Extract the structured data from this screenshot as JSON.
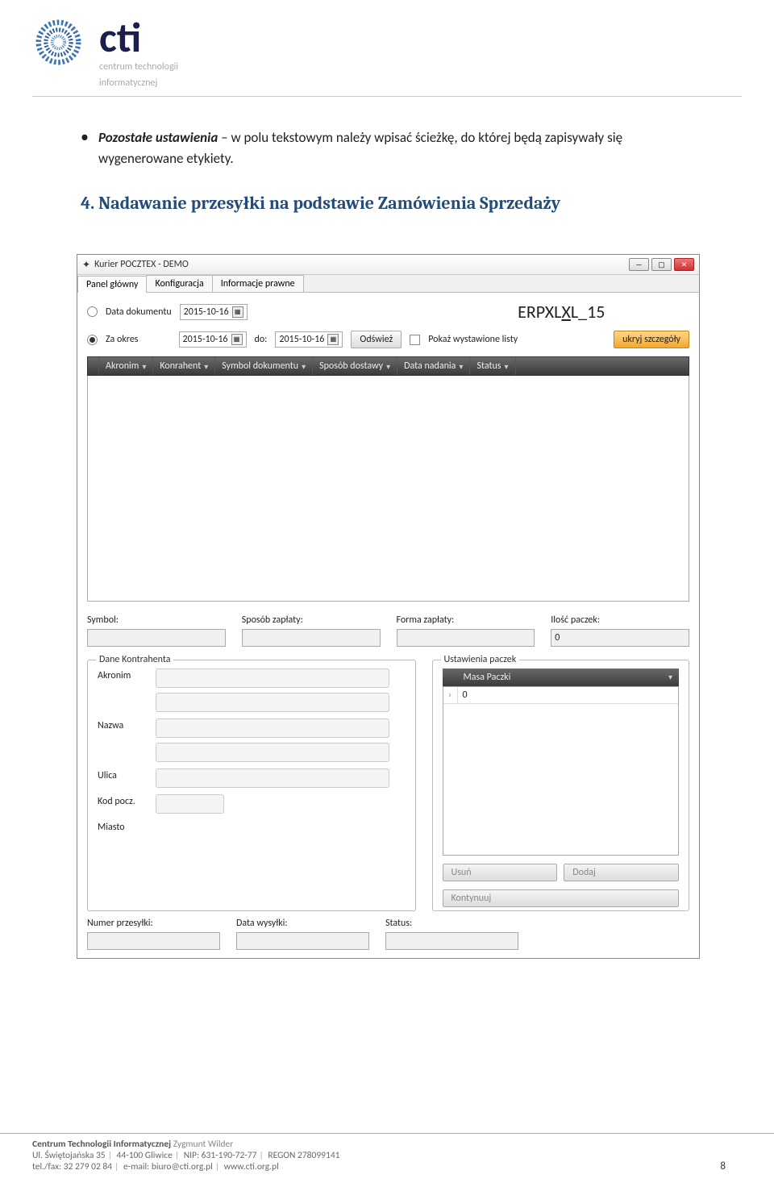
{
  "header": {
    "brand": "cti",
    "sub1": "centrum technologii",
    "sub2": "informatycznej"
  },
  "bullet": {
    "term": "Pozostałe ustawienia",
    "rest": " – w polu tekstowym należy wpisać ścieżkę, do której będą zapisywały się wygenerowane etykiety."
  },
  "heading": "4. Nadawanie przesyłki na podstawie Zamówienia Sprzedaży",
  "win": {
    "title": "Kurier POCZTEX - DEMO",
    "min": "—",
    "max": "▢",
    "close": "✕"
  },
  "tabs": [
    "Panel główny",
    "Konfiguracja",
    "Informacje prawne"
  ],
  "filters": {
    "docDateLbl": "Data dokumentu",
    "docDate": "2015-10-16",
    "periodLbl": "Za okres",
    "from": "2015-10-16",
    "doLbl": "do:",
    "to": "2015-10-16",
    "refresh": "Odśwież",
    "showLbl": "Pokaż wystawione listy",
    "hideBtn": "ukryj szczegóły",
    "erp": "ERPXLXL_15"
  },
  "gridCols": [
    "Akronim",
    "Konrahent",
    "Symbol dokumentu",
    "Sposób dostawy",
    "Data nadania",
    "Status"
  ],
  "form": {
    "symbolLbl": "Symbol:",
    "sposobLbl": "Sposób zapłaty:",
    "formaLbl": "Forma zapłaty:",
    "iloscLbl": "Ilość paczek:",
    "iloscVal": "0"
  },
  "kont": {
    "title": "Dane Kontrahenta",
    "akronim": "Akronim",
    "nazwa": "Nazwa",
    "ulica": "Ulica",
    "kod": "Kod pocz.",
    "miasto": "Miasto"
  },
  "paczki": {
    "title": "Ustawienia paczek",
    "col": "Masa Paczki",
    "val": "0",
    "usun": "Usuń",
    "dodaj": "Dodaj",
    "kont": "Kontynuuj"
  },
  "bottom": {
    "numerLbl": "Numer przesyłki:",
    "dataLbl": "Data wysyłki:",
    "statusLbl": "Status:"
  },
  "footer": {
    "company": "Centrum Technologii Informatycznej",
    "name": "Zygmunt Wilder",
    "addr": "Ul. Świętojańska 35",
    "city": "44-100 Gliwice",
    "nip": "NIP: 631-190-72-77",
    "regon": "REGON 278099141",
    "tel": "tel./fax: 32 279 02 84",
    "email": "e-mail: biuro@cti.org.pl",
    "web": "www.cti.org.pl",
    "page": "8"
  }
}
